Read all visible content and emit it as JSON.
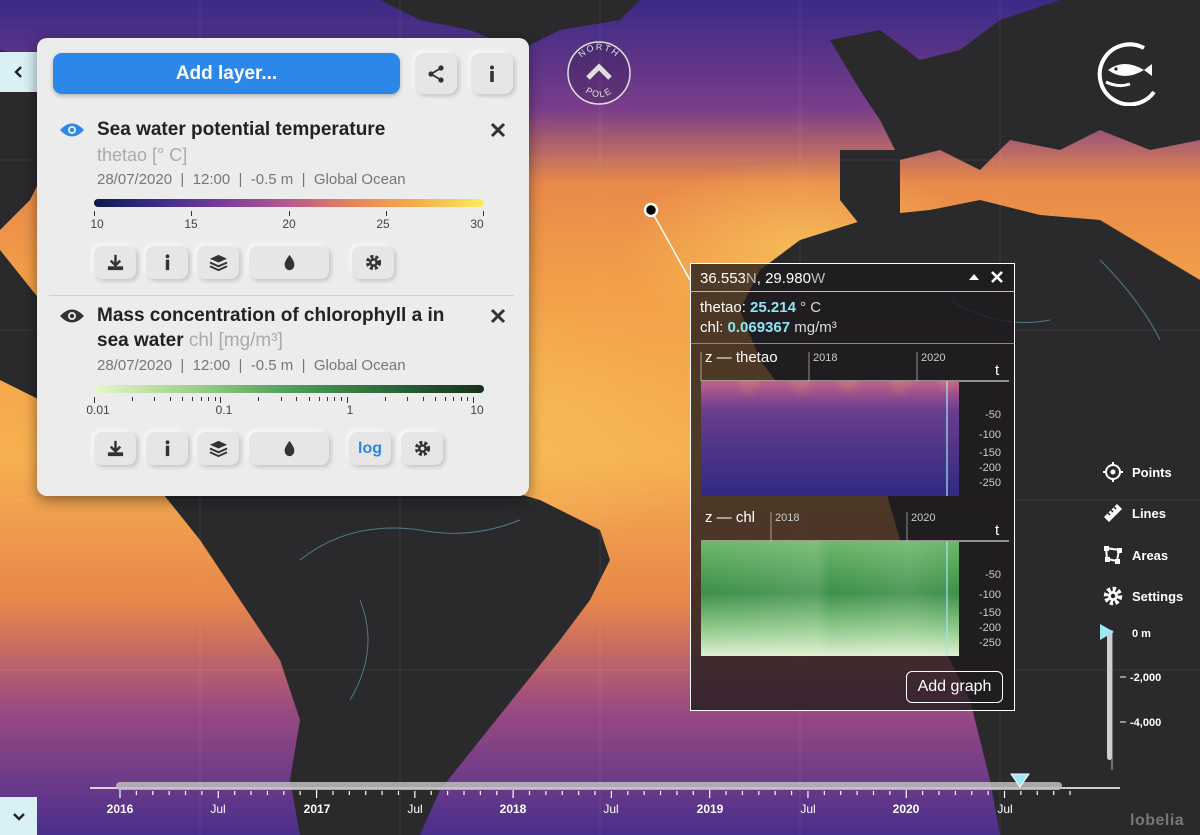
{
  "panel": {
    "add_layer_label": "Add layer...",
    "layers": [
      {
        "title": "Sea water potential temperature",
        "variable": "thetao [° C]",
        "date": "28/07/2020",
        "time": "12:00",
        "depth": "-0.5 m",
        "region": "Global Ocean",
        "scale_labels": [
          "10",
          "15",
          "20",
          "25",
          "30"
        ]
      },
      {
        "title_line1": "Mass concentration of chlorophyll a in",
        "title_line2": "sea water",
        "variable": "chl [mg/m³]",
        "date": "28/07/2020",
        "time": "12:00",
        "depth": "-0.5 m",
        "region": "Global Ocean",
        "scale_labels": [
          "0.01",
          "0.1",
          "1",
          "10"
        ],
        "log_label": "log"
      }
    ]
  },
  "compass": {
    "line1": "NORTH",
    "line2": "POLE"
  },
  "popup": {
    "lat": "36.553",
    "lat_unit": "N",
    "lon": "29.980",
    "lon_unit": "W",
    "v1_name": "thetao:",
    "v1_value": "25.214",
    "v1_unit": "° C",
    "v2_name": "chl:",
    "v2_value": "0.069367",
    "v2_unit": "mg/m³",
    "graph1_title": "z — thetao",
    "graph2_title": "z — chl",
    "year_2018": "2018",
    "year_2020": "2020",
    "t_label": "t",
    "depths": [
      "-50",
      "-100",
      "-150",
      "-200",
      "-250"
    ],
    "add_graph_label": "Add graph"
  },
  "tools": {
    "points": "Points",
    "lines": "Lines",
    "areas": "Areas",
    "settings": "Settings"
  },
  "depth_slider": {
    "labels": [
      "0 m",
      "-2,000",
      "-4,000"
    ]
  },
  "timeline": {
    "labels": [
      "2016",
      "Jul",
      "2017",
      "Jul",
      "2018",
      "Jul",
      "2019",
      "Jul",
      "2020",
      "Jul"
    ]
  },
  "brand": "lobelia",
  "colors": {
    "accent": "#2b87e8",
    "popup_value": "#8fe4f5",
    "tab_bg": "#d9f0f5"
  }
}
